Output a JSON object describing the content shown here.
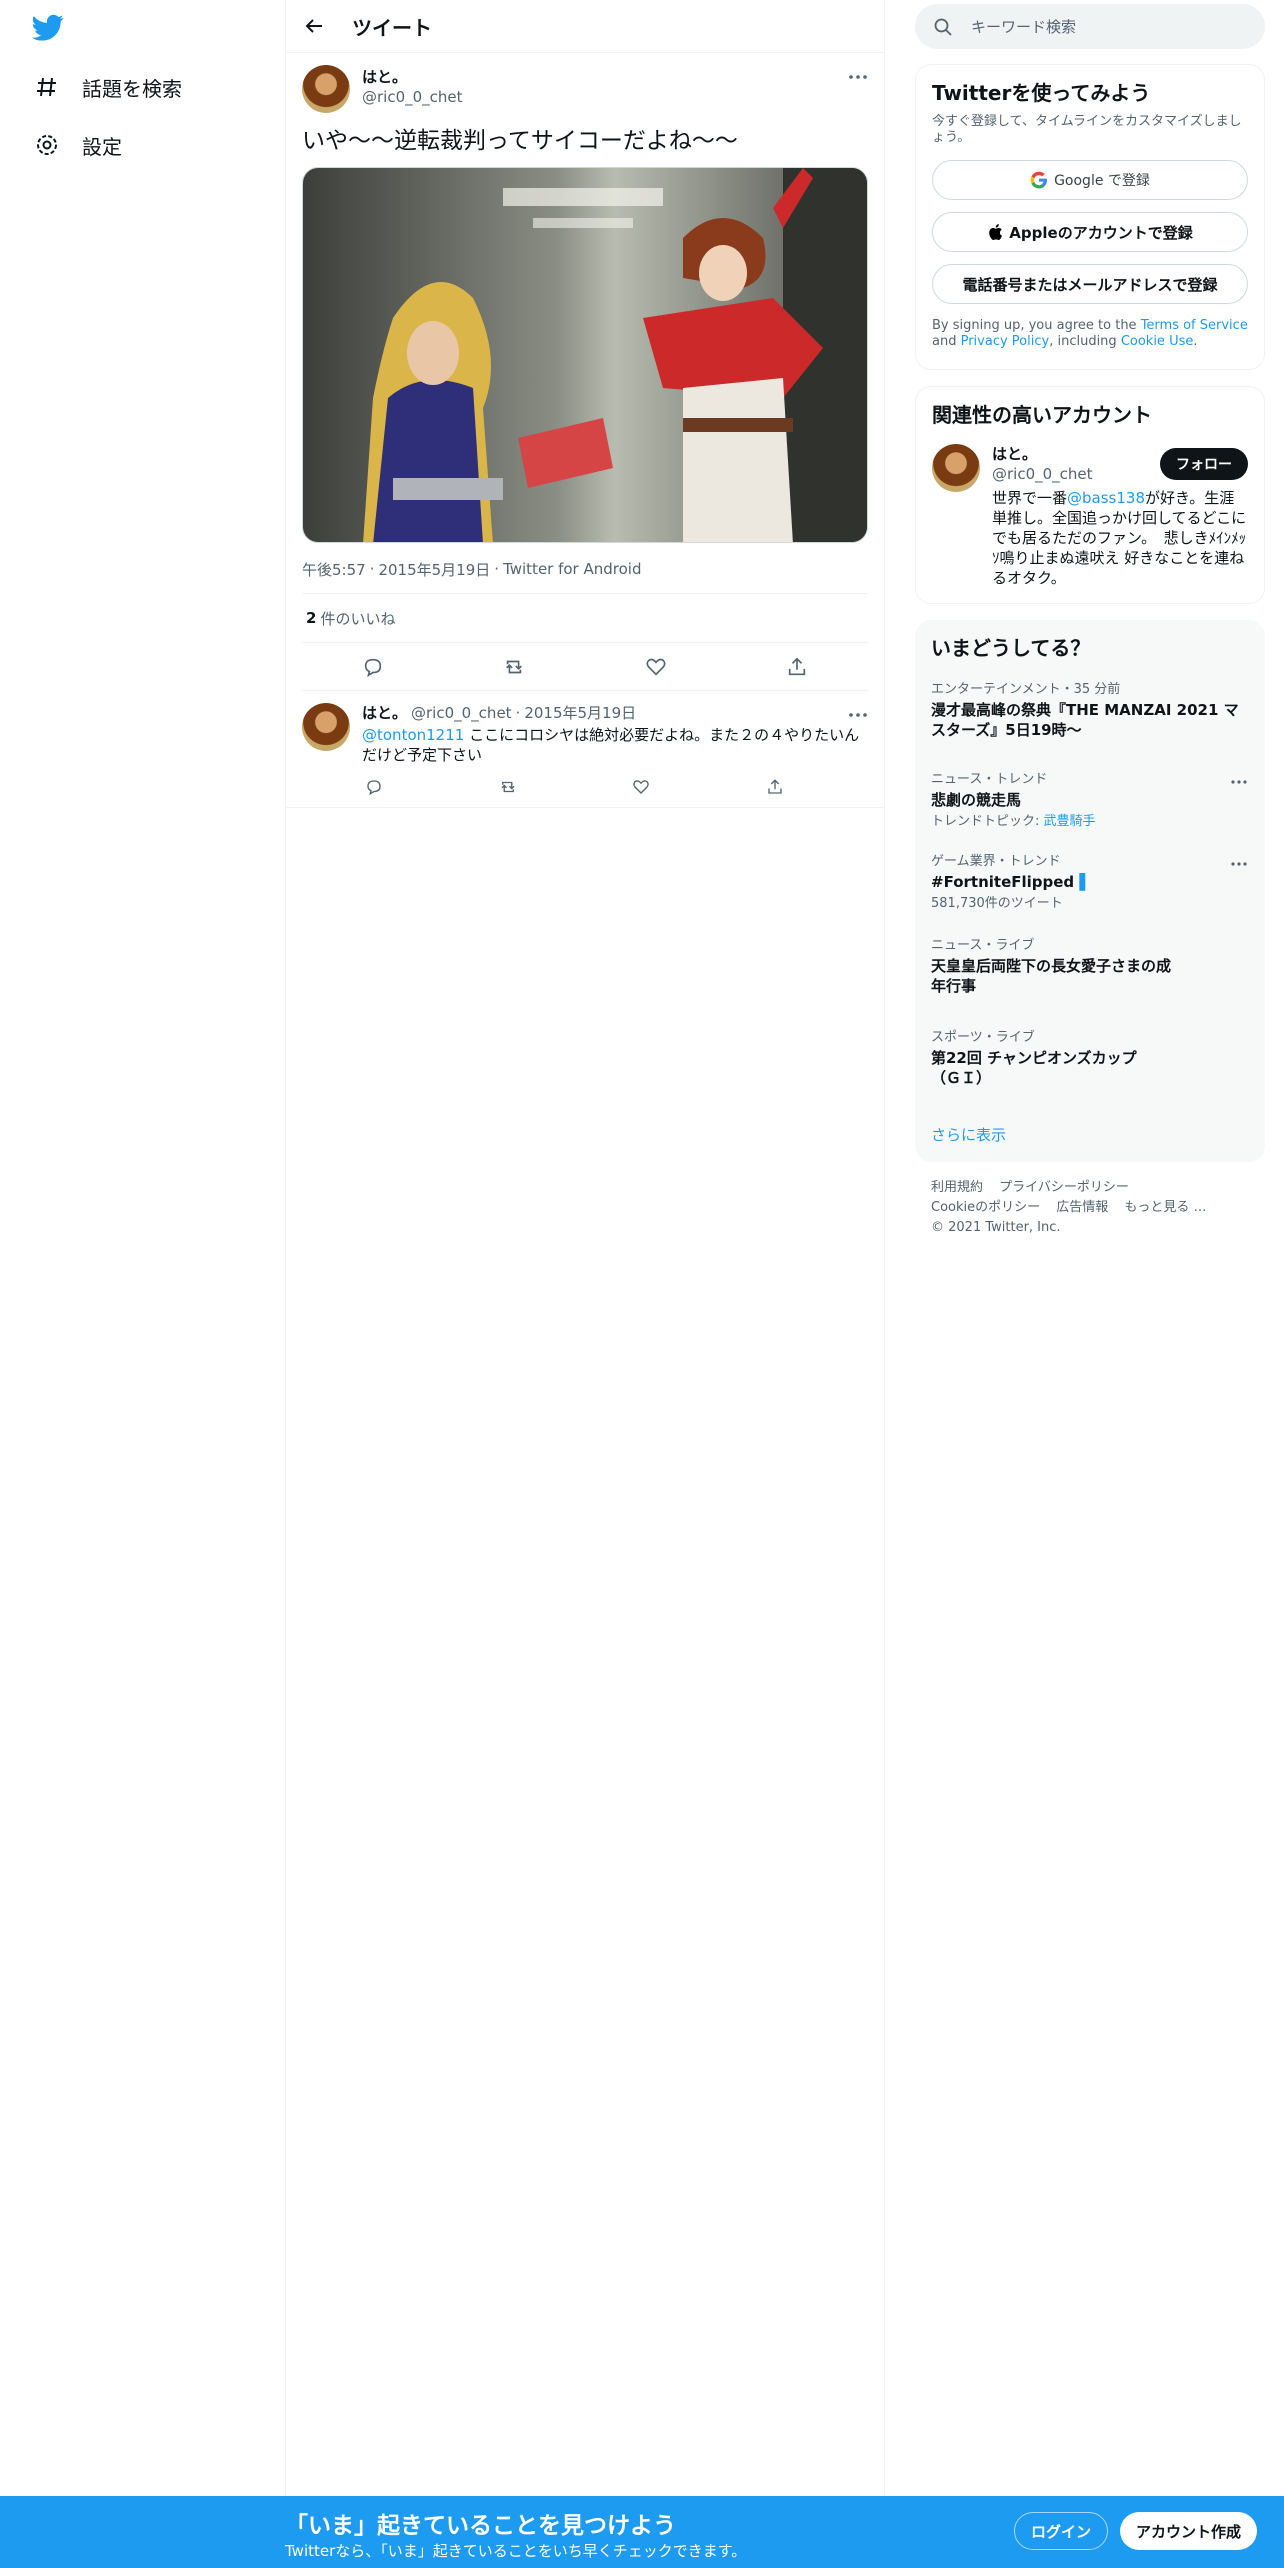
{
  "nav": {
    "explore_label": "話題を検索",
    "settings_label": "設定"
  },
  "header": {
    "title": "ツイート"
  },
  "tweet": {
    "author_name": "はと。",
    "author_handle": "@ric0_0_chet",
    "text": "いや～～逆転裁判ってサイコーだよね～～",
    "time": "午後5:57",
    "date": "2015年5月19日",
    "source": "Twitter for Android",
    "likes_count": "2",
    "likes_label": "件のいいね"
  },
  "reply": {
    "author_name": "はと。",
    "author_handle": "@ric0_0_chet",
    "date": "2015年5月19日",
    "mention": "@tonton1211",
    "text": " ここにコロシヤは絶対必要だよね。また２の４やりたいんだけど予定下さい"
  },
  "search": {
    "placeholder": "キーワード検索"
  },
  "signup_card": {
    "title": "Twitterを使ってみよう",
    "subtitle": "今すぐ登録して、タイムラインをカスタマイズしましょう。",
    "google_label": "Google で登録",
    "apple_label": "Appleのアカウントで登録",
    "phone_label": "電話番号またはメールアドレスで登録",
    "terms_prefix": "By signing up, you agree to the ",
    "terms_link": "Terms of Service",
    "terms_and": " and ",
    "privacy_link": "Privacy Policy",
    "terms_including": ", including ",
    "cookie_link": "Cookie Use",
    "terms_end": "."
  },
  "related": {
    "title": "関連性の高いアカウント",
    "name": "はと。",
    "handle": "@ric0_0_chet",
    "follow_label": "フォロー",
    "bio_prefix": "世界で一番",
    "bio_mention": "@bass138",
    "bio_rest": "が好き。生涯単推し。全国追っかけ回してるどこにでも居るただのファン。　悲しきﾒｲﾝﾒｯｿ鳴り止まぬ遠吠え 好きなことを連ねるオタク。"
  },
  "trends": {
    "title": "いまどうしてる？",
    "items": [
      {
        "context": "エンターテインメント・35 分前",
        "name": "漫才最高峰の祭典『THE MANZAI 2021 マスターズ』5日19時〜"
      },
      {
        "context": "ニュース・トレンド",
        "name": "悲劇の競走馬",
        "sub_prefix": "トレンドトピック: ",
        "sub_link": "武豊騎手"
      },
      {
        "context": "ゲーム業界・トレンド",
        "name": "#FortniteFlipped",
        "sub": "581,730件のツイート"
      },
      {
        "context": "ニュース・ライブ",
        "name": "天皇皇后両陛下の長女愛子さまの成年行事"
      },
      {
        "context": "スポーツ・ライブ",
        "name": "第22回 チャンピオンズカップ（ＧＩ）"
      }
    ],
    "show_more": "さらに表示"
  },
  "footer": {
    "terms": "利用規約",
    "privacy": "プライバシーポリシー",
    "cookie": "Cookieのポリシー",
    "ads": "広告情報",
    "more": "もっと見る …",
    "copyright": "© 2021 Twitter, Inc."
  },
  "bottom_bar": {
    "title": "「いま」起きていることを見つけよう",
    "subtitle": "Twitterなら、「いま」起きていることをいち早くチェックできます。",
    "login_label": "ログイン",
    "signup_label": "アカウント作成"
  },
  "colors": {
    "brand": "#1d9bf0",
    "text": "#0f1419",
    "muted": "#536471"
  }
}
